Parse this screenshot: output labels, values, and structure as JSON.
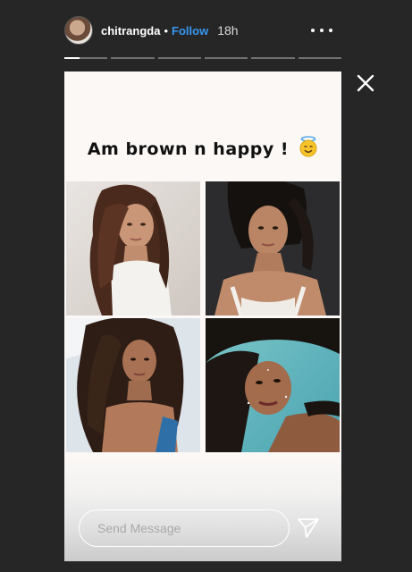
{
  "header": {
    "username": "chitrangda",
    "separator": "•",
    "follow_label": "Follow",
    "timestamp": "18h"
  },
  "progress": {
    "segments": 6,
    "current_index": 0,
    "current_fill": 0.35
  },
  "story": {
    "caption": "Am brown n happy !",
    "caption_emoji": "smiling-face-with-halo-icon",
    "photos": [
      {
        "id": "photo-1"
      },
      {
        "id": "photo-2"
      },
      {
        "id": "photo-3"
      },
      {
        "id": "photo-4"
      }
    ]
  },
  "reply": {
    "placeholder": "Send Message"
  },
  "colors": {
    "background": "#262626",
    "follow": "#3897f0",
    "card": "#fbf8f6"
  },
  "icons": {
    "close": "close-icon",
    "more": "more-options-icon",
    "send": "send-icon"
  }
}
